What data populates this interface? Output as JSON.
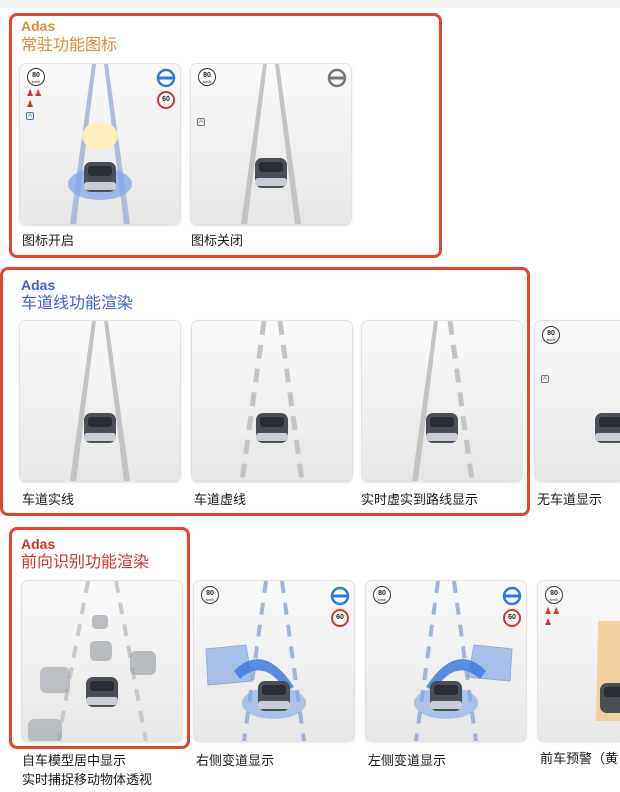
{
  "colors": {
    "accent_orange": "#e08a35",
    "accent_blue": "#3d60d8",
    "accent_red": "#d8332a",
    "frame_red": "#e0462f",
    "steering_blue": "#2c7be5"
  },
  "sections": [
    {
      "tag": "Adas",
      "title": "常驻功能图标",
      "color": "#e08a35",
      "cards": [
        {
          "caption": "图标开启",
          "speed": "80",
          "limit": "60"
        },
        {
          "caption": "图标关闭",
          "speed": "80"
        }
      ]
    },
    {
      "tag": "Adas",
      "title": "车道线功能渲染",
      "color": "#3d60d8",
      "cards": [
        {
          "caption": "车道实线"
        },
        {
          "caption": "车道虚线"
        },
        {
          "caption": "实时虚实到路线显示"
        },
        {
          "caption": "无车道显示",
          "speed": "80"
        }
      ]
    },
    {
      "tag": "Adas",
      "title": "前向识别功能渲染",
      "color": "#d8332a",
      "cards": [
        {
          "caption_lines": [
            "自车模型居中显示",
            "实时捕捉移动物体透视"
          ]
        },
        {
          "caption": "右侧变道显示",
          "speed": "80",
          "limit": "60"
        },
        {
          "caption": "左侧变道显示",
          "speed": "80",
          "limit": "60"
        },
        {
          "caption": "前车预警（黄",
          "speed": "80"
        }
      ]
    }
  ]
}
